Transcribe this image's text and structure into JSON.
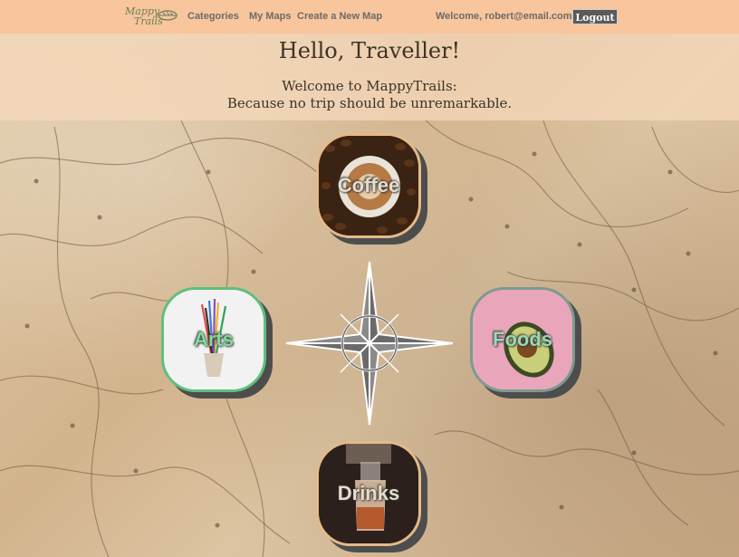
{
  "nav": {
    "logo_line1": "Mappy",
    "logo_line2": "Trails",
    "links": [
      {
        "label": "Categories"
      },
      {
        "label": "My Maps"
      },
      {
        "label": "Create a New Map"
      }
    ],
    "welcome": "Welcome, robert@email.com!",
    "logout_label": "Logout"
  },
  "hero": {
    "title": "Hello, Traveller!",
    "subtitle_line1": "Welcome to MappyTrails:",
    "subtitle_line2": "Because no trip should be unremarkable."
  },
  "categories": [
    {
      "label": "Coffee",
      "icon": "coffee-cup-image"
    },
    {
      "label": "Arts",
      "icon": "pencils-cup-image"
    },
    {
      "label": "Foods",
      "icon": "avocado-image"
    },
    {
      "label": "Drinks",
      "icon": "cocktail-glass-image"
    }
  ],
  "colors": {
    "navbar": "#f8c59c",
    "logout_bg": "#5a5a5a",
    "coffee_border": "#e5b98a",
    "arts_border": "#5fbf7f",
    "foods_border": "#7d9a8f"
  }
}
